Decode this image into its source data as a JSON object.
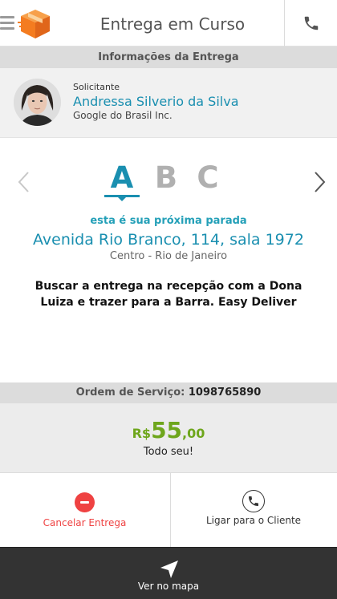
{
  "header": {
    "title": "Entrega em Curso",
    "menu_icon": "menu-icon",
    "logo_icon": "cube-box-logo",
    "phone_icon": "phone-icon",
    "logo_color": "#f47c20"
  },
  "info_bar": {
    "label": "Informações da Entrega"
  },
  "requester": {
    "label": "Solicitante",
    "name": "Andressa Silverio da Silva",
    "company": "Google do Brasil Inc.",
    "name_color": "#1a8fb0"
  },
  "stops": {
    "letters": [
      "A",
      "B",
      "C"
    ],
    "active_letter": "A",
    "next_stop_label": "esta é sua próxima parada",
    "address": "Avenida Rio Branco, 114, sala 1972",
    "district": "Centro - Rio de Janeiro",
    "instructions": "Buscar a entrega na recepção com a Dona Luiza e trazer para a Barra. Easy Deliver",
    "active_color": "#1a8fb0",
    "inactive_color": "#b0b0b0"
  },
  "service_order": {
    "label": "Ordem de Serviço:",
    "number": "1098765890"
  },
  "price": {
    "currency": "R$",
    "integer": "55",
    "decimal": ",00",
    "subtitle": "Todo seu!",
    "color": "#6ea61c"
  },
  "actions": {
    "cancel_label": "Cancelar Entrega",
    "cancel_icon": "minus-circle-icon",
    "cancel_color": "#ef4242",
    "call_label": "Ligar para o Cliente",
    "call_icon": "phone-circle-icon"
  },
  "map_bar": {
    "label": "Ver no mapa",
    "icon": "navigation-arrow-icon",
    "background": "#333333"
  }
}
